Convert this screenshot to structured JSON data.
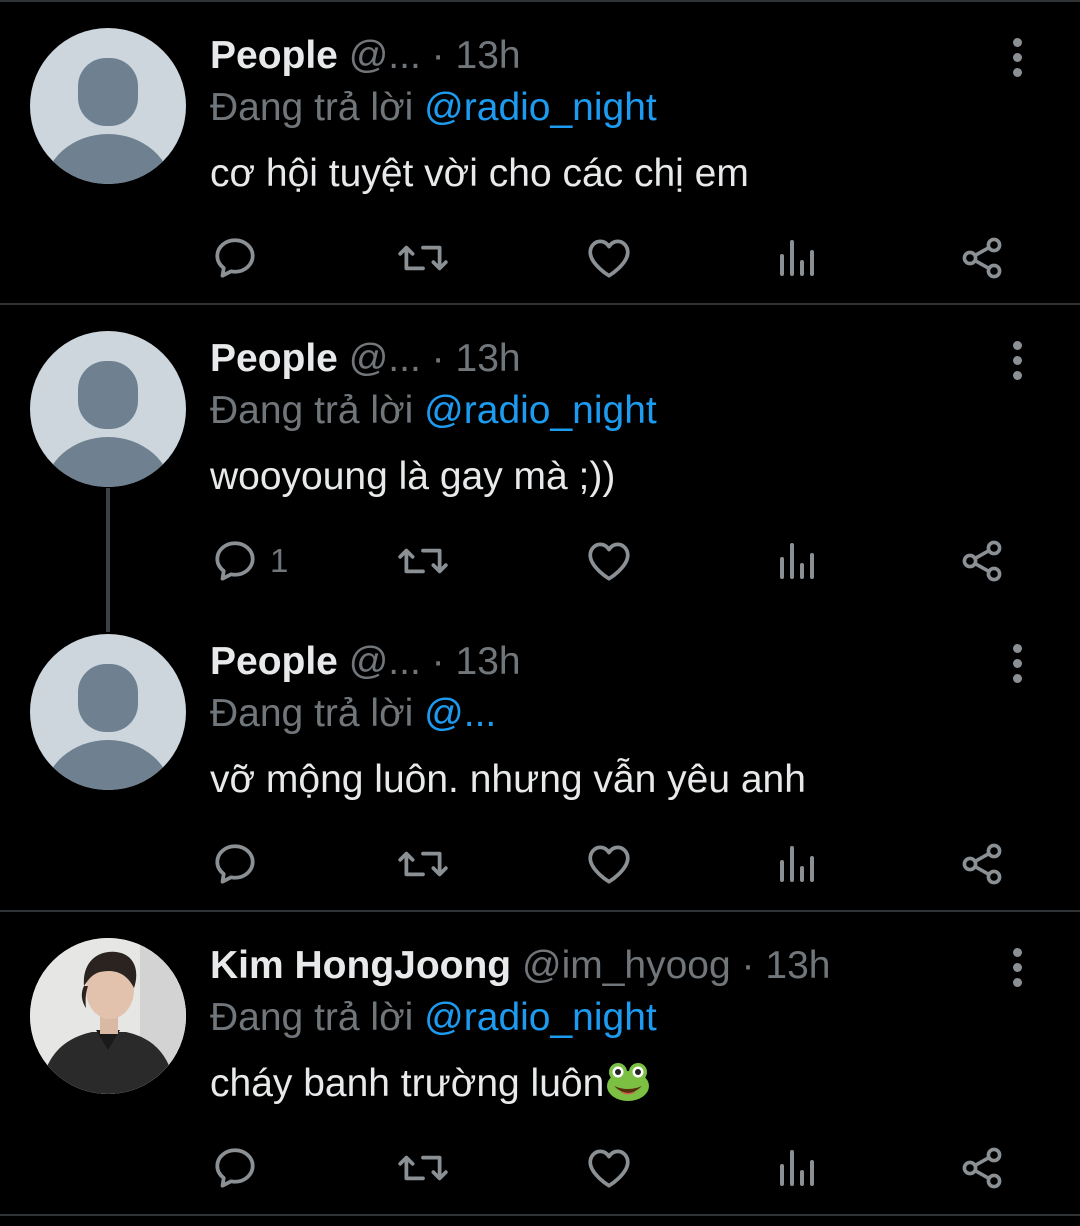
{
  "tweets": [
    {
      "name": "People",
      "handle": "@...",
      "time": "13h",
      "reply_prefix": "Đang trả lời",
      "reply_to": "@radio_night",
      "text": "cơ hội tuyệt vời cho các chị em",
      "reply_count": "",
      "avatar": "default-avatar"
    },
    {
      "name": "People",
      "handle": "@...",
      "time": "13h",
      "reply_prefix": "Đang trả lời",
      "reply_to": "@radio_night",
      "text": "wooyoung là gay mà ;))",
      "reply_count": "1",
      "avatar": "default-avatar"
    },
    {
      "name": "People",
      "handle": "@...",
      "time": "13h",
      "reply_prefix": "Đang trả lời",
      "reply_to": "@...",
      "text": "vỡ mộng luôn. nhưng vẫn yêu anh",
      "reply_count": "",
      "avatar": "default-avatar"
    },
    {
      "name": "Kim HongJoong",
      "handle": "@im_hyoog",
      "time": "13h",
      "reply_prefix": "Đang trả lời",
      "reply_to": "@radio_night",
      "text": "cháy banh trường luôn",
      "text_emoji": "frog-emoji",
      "reply_count": "",
      "avatar": "profile-photo"
    }
  ],
  "separator": "·",
  "icons": [
    "reply-icon",
    "retweet-icon",
    "like-icon",
    "analytics-icon",
    "share-icon",
    "more-options-icon"
  ],
  "colors": {
    "background": "#000000",
    "text": "#e7e9ea",
    "muted": "#71767b",
    "link": "#1d9bf0",
    "divider": "#2f3336"
  }
}
